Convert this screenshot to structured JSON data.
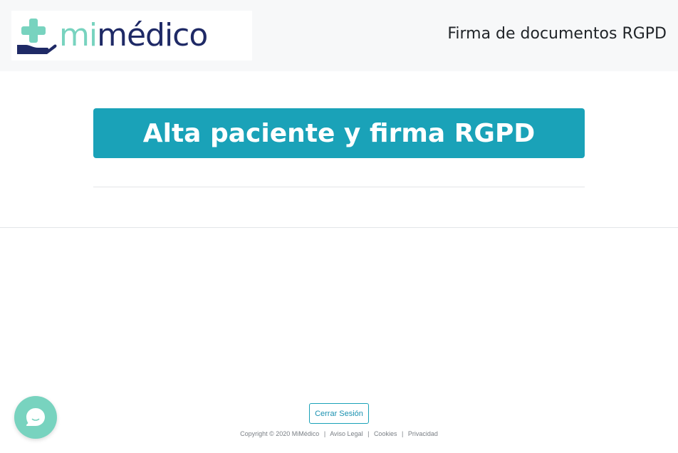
{
  "header": {
    "logo": {
      "mi": "mi",
      "medico": "médico"
    },
    "title": "Firma de documentos RGPD"
  },
  "main": {
    "banner_label": "Alta paciente y firma RGPD"
  },
  "footer": {
    "logout_label": "Cerrar Sesión",
    "copyright": "Copyright © 2020 MiMédico",
    "links": [
      "Aviso Legal",
      "Cookies",
      "Privacidad"
    ],
    "separator": "|"
  },
  "colors": {
    "accent": "#1aa2b8",
    "logo_mint": "#78d3bf",
    "logo_navy": "#1f2a66",
    "header_bg": "#f7f8f9"
  },
  "icons": {
    "logo_mark": "hand-holding-cross-icon",
    "chat": "chat-bubble-icon"
  }
}
